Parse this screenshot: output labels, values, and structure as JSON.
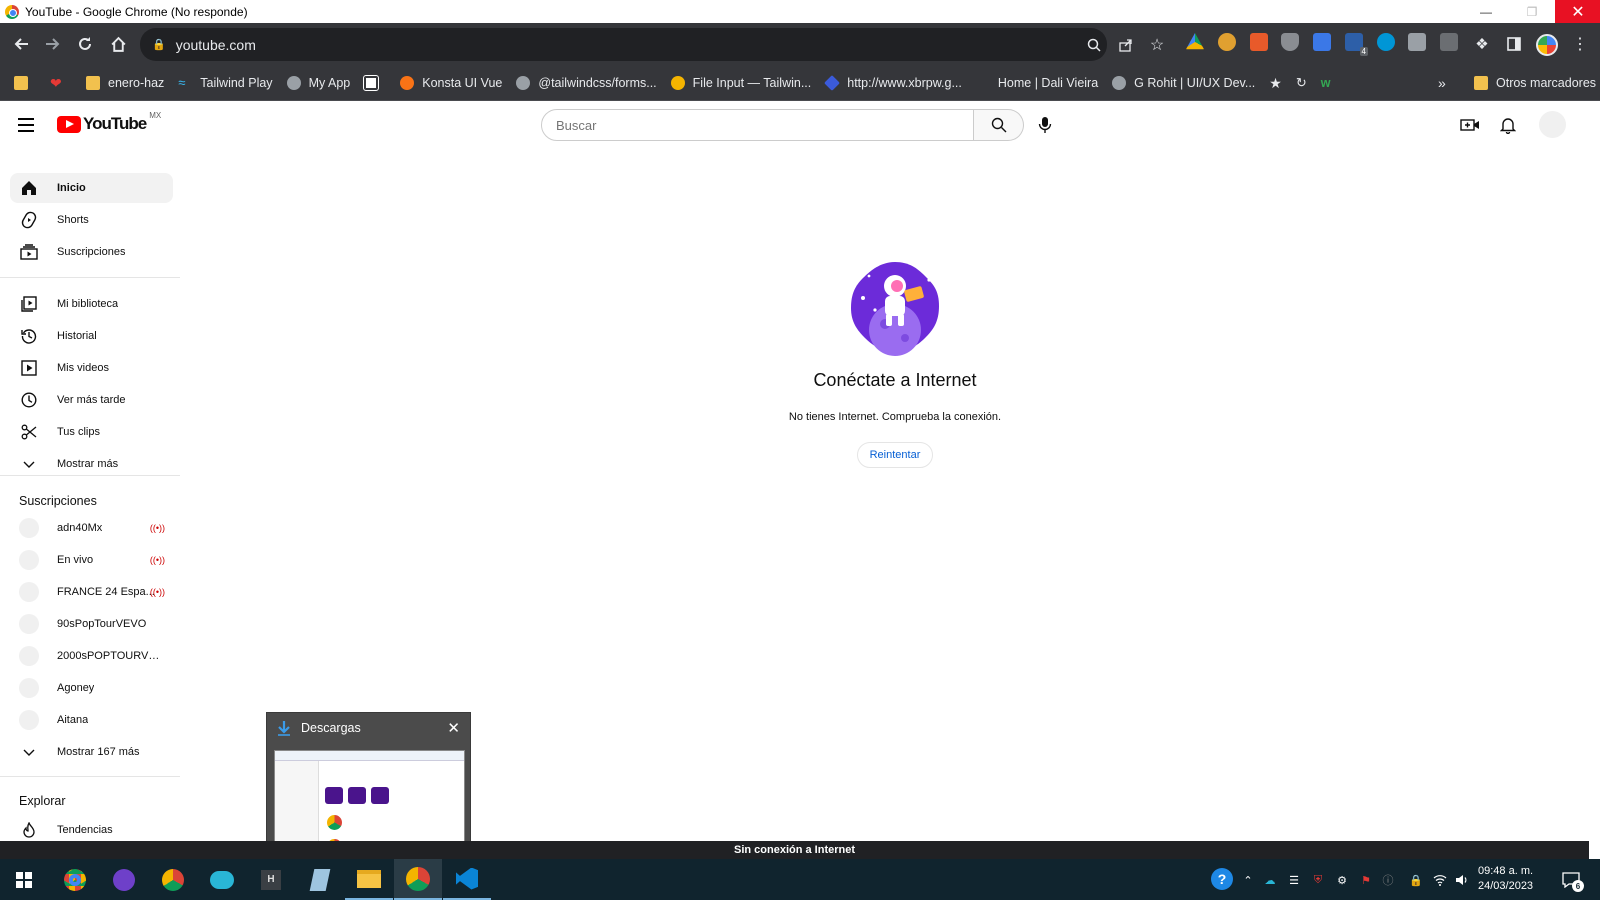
{
  "window": {
    "title": "YouTube - Google Chrome (No responde)"
  },
  "browser": {
    "url": "youtube.com",
    "bookmarks": [
      {
        "label": ""
      },
      {
        "label": ""
      },
      {
        "label": "enero-haz"
      },
      {
        "label": "Tailwind Play"
      },
      {
        "label": "My App"
      },
      {
        "label": ""
      },
      {
        "label": "Konsta UI Vue"
      },
      {
        "label": "@tailwindcss/forms..."
      },
      {
        "label": "File Input — Tailwin..."
      },
      {
        "label": "http://www.xbrpw.g..."
      },
      {
        "label": "Home | Dali Vieira"
      },
      {
        "label": "G Rohit | UI/UX Dev..."
      }
    ],
    "overflow_label": "»",
    "other_bookmarks": "Otros marcadores"
  },
  "youtube": {
    "logo_text": "YouTube",
    "country_code": "MX",
    "search_placeholder": "Buscar",
    "nav": [
      {
        "label": "Inicio"
      },
      {
        "label": "Shorts"
      },
      {
        "label": "Suscripciones"
      }
    ],
    "library": [
      {
        "label": "Mi biblioteca"
      },
      {
        "label": "Historial"
      },
      {
        "label": "Mis videos"
      },
      {
        "label": "Ver más tarde"
      },
      {
        "label": "Tus clips"
      },
      {
        "label": "Mostrar más"
      }
    ],
    "subscriptions_title": "Suscripciones",
    "subscriptions": [
      {
        "label": "adn40Mx",
        "live": "((•))"
      },
      {
        "label": "En vivo",
        "live": "((•))"
      },
      {
        "label": "FRANCE 24 Espa...",
        "live": "((•))"
      },
      {
        "label": "90sPopTourVEVO",
        "live": ""
      },
      {
        "label": "2000sPOPTOURVE...",
        "live": ""
      },
      {
        "label": "Agoney",
        "live": ""
      },
      {
        "label": "Aitana",
        "live": ""
      },
      {
        "label": "Mostrar 167 más",
        "live": ""
      }
    ],
    "explore_title": "Explorar",
    "explore": [
      {
        "label": "Tendencias"
      }
    ],
    "offline": {
      "title": "Conéctate a Internet",
      "subtitle": "No tienes Internet. Comprueba la conexión.",
      "retry": "Reintentar"
    },
    "offline_bar": "Sin conexión a Internet"
  },
  "downloads_popup": {
    "title": "Descargas"
  },
  "taskbar": {
    "time": "09:48 a. m.",
    "date": "24/03/2023",
    "notification_count": "6",
    "extension_badge": "4"
  },
  "colors": {
    "chrome_dark": "#35363a",
    "youtube_red": "#ff0000",
    "link_blue": "#065fd4",
    "taskbar": "#10242e"
  }
}
